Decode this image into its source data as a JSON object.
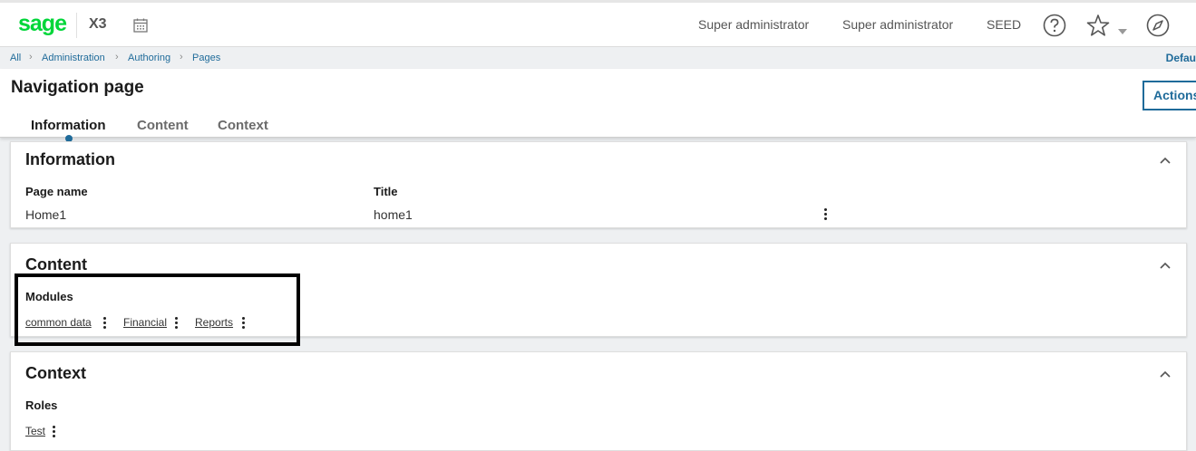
{
  "header": {
    "logo": "sage",
    "product": "X3",
    "user_1": "Super administrator",
    "user_2": "Super administrator",
    "folder": "SEED"
  },
  "breadcrumb": {
    "items": [
      "All",
      "Administration",
      "Authoring",
      "Pages"
    ],
    "right_label": "Defau"
  },
  "page": {
    "title": "Navigation page",
    "actions_label": "Actions",
    "tabs": [
      {
        "label": "Information",
        "active": true
      },
      {
        "label": "Content",
        "active": false
      },
      {
        "label": "Context",
        "active": false
      }
    ]
  },
  "information": {
    "title": "Information",
    "page_name_label": "Page name",
    "page_name_value": "Home1",
    "title_label": "Title",
    "title_value": "home1"
  },
  "content": {
    "title": "Content",
    "modules_label": "Modules",
    "modules": [
      "common data",
      "Financial",
      "Reports"
    ]
  },
  "context": {
    "title": "Context",
    "roles_label": "Roles",
    "roles": [
      "Test"
    ]
  },
  "colors": {
    "brand": "#00d639",
    "accent": "#1f6b9a"
  },
  "icons": {
    "calendar": "calendar-icon",
    "help": "help-icon",
    "favorite": "star-icon",
    "navigate": "compass-icon",
    "collapse": "chevron-up-icon",
    "more": "kebab-menu-icon"
  }
}
